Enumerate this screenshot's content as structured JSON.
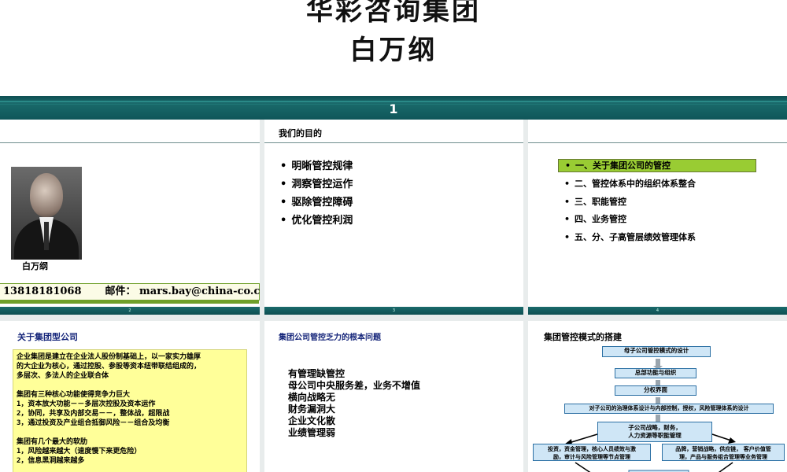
{
  "header": {
    "title_line1": "华彩咨询集团",
    "title_line2": "白万纲",
    "page_number": "1"
  },
  "slide_author": {
    "name": "白万纲",
    "phone": "13818181068",
    "email_label": "邮件：",
    "email": "mars.bay@china-co.com",
    "footer_num": "2"
  },
  "slide_purpose": {
    "heading": "我们的目的",
    "bullets": [
      "明晰管控规律",
      "洞察管控运作",
      "驱除管控障碍",
      "优化管控利润"
    ],
    "footer_num": "3"
  },
  "slide_toc": {
    "items": [
      "一、关于集团公司的管控",
      "二、管控体系中的组织体系整合",
      "三、职能管控",
      "四、业务管控",
      "五、分、子高管层绩效管理体系"
    ],
    "active_index": 0,
    "footer_num": "4"
  },
  "slide_group": {
    "title": "关于集团型公司",
    "para1": [
      "企业集团是建立在企业法人股份制基础上，以一家实力雄厚",
      "的大企业为核心，通过控股、参股等资本纽带联结组成的，",
      "多层次、多法人的企业联合体"
    ],
    "para2": [
      "集团有三种核心功能使得竞争力巨大",
      "1，资本放大功能－－多层次控股及资本运作",
      "2，协同，共享及内部交易－－，整体战，超限战",
      "3，通过投资及产业组合抵御风险－－组合及均衡"
    ],
    "para3": [
      "集团有几个最大的软肋",
      "1，风险越来越大（速度慢下来更危险）",
      "2，信息黑洞越来越多"
    ]
  },
  "slide_problems": {
    "title": "集团公司管控乏力的根本问题",
    "items": [
      "有管理缺管控",
      "母公司中央服务差，业务不增值",
      "横向战略无",
      "财务漏洞大",
      "企业文化散",
      "业绩管理弱"
    ]
  },
  "slide_model": {
    "title": "集团管控模式的搭建",
    "boxes": {
      "design": "母子公司管控模式的设计",
      "hq": "总部功能与组织",
      "interface": "分权界面",
      "governance": "对子公司的治理体系设计与内部控制，授权，风险管理体系的设计",
      "strategy_l1": "子公司战略，财务，",
      "strategy_l2": "人力资源等职能管理",
      "left_l1": "投资，资金管理，核心人员绩效与激",
      "left_l2": "励，审计与风险管理等节点管理",
      "right_l1": "品牌，营销战略，供应链， 客户价值管",
      "right_l2": "理，产品与服务组合管理等业务管理"
    }
  },
  "colors": {
    "band_teal": "#0f5659",
    "accent_green": "#99cc33",
    "note_yellow": "#ffff99",
    "title_blue": "#15257a",
    "flow_box": "#cfe6f6"
  }
}
